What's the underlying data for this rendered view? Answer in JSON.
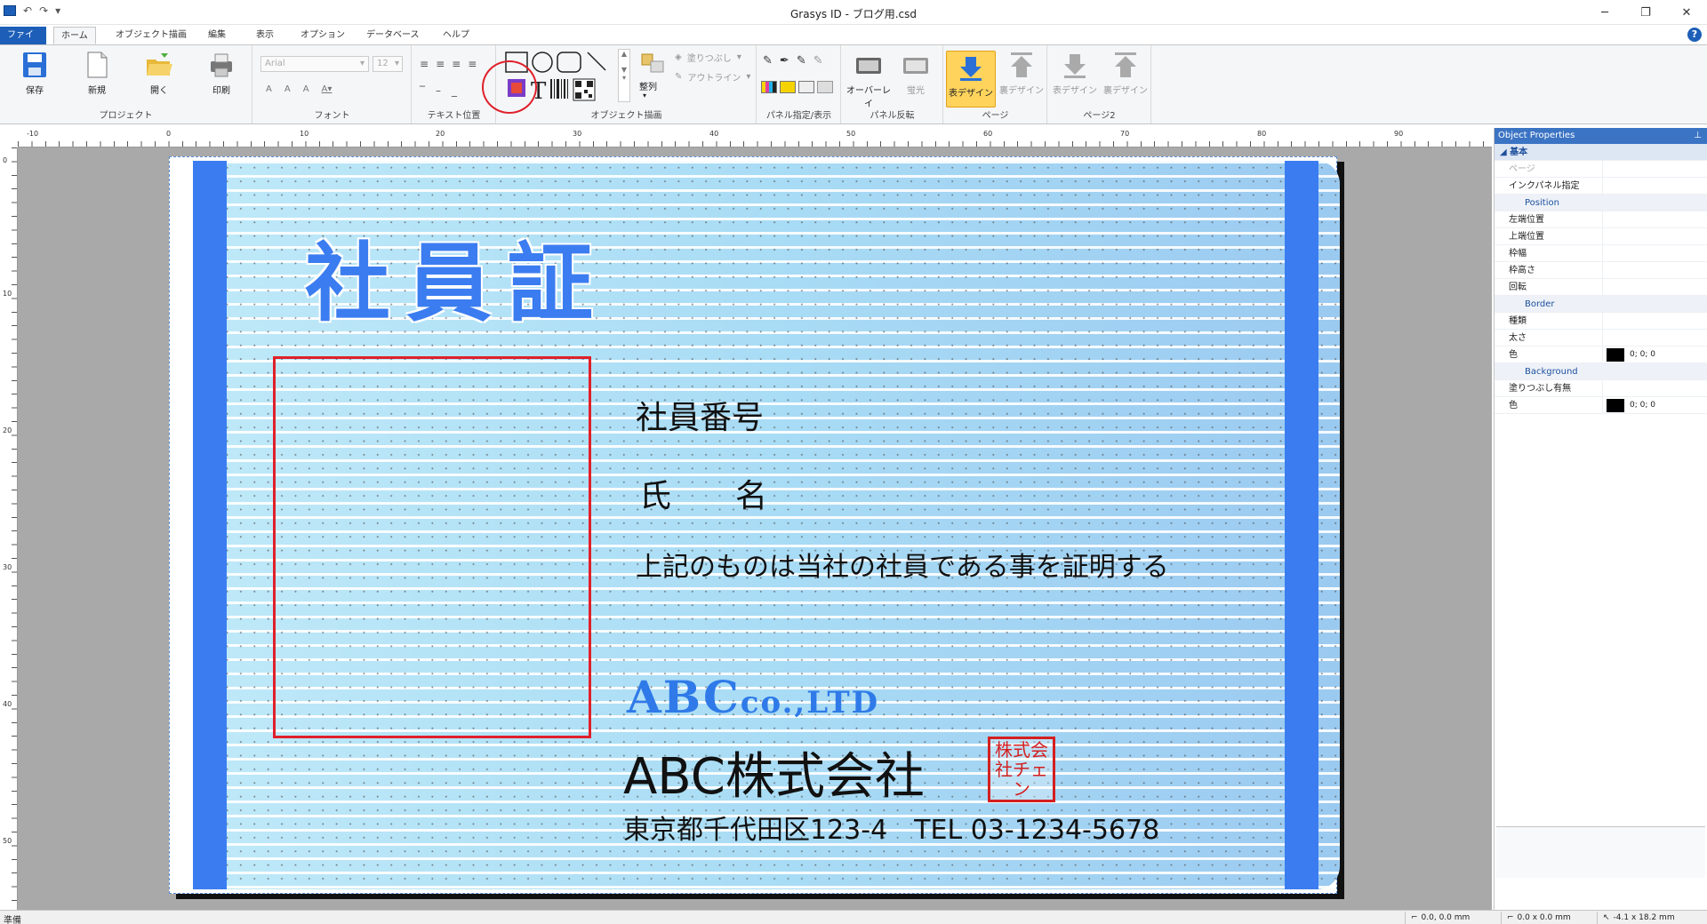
{
  "window": {
    "title": "Grasys ID - ブログ用.csd",
    "minimize": "─",
    "maximize": "❐",
    "close": "✕"
  },
  "tabs": [
    "ファイル",
    "ホーム",
    "オブジェクト描画",
    "編集",
    "表示",
    "オプション",
    "データベース",
    "ヘルプ"
  ],
  "ribbon": {
    "project": {
      "label": "プロジェクト",
      "save": "保存",
      "new": "新規",
      "open": "開く",
      "print": "印刷"
    },
    "font": {
      "label": "フォント",
      "family_value": "Arial",
      "size_value": "12"
    },
    "text_position": {
      "label": "テキスト位置"
    },
    "object_draw": {
      "label": "オブジェクト描画",
      "arrange": "整列",
      "fill": "塗りつぶし",
      "outline": "アウトライン"
    },
    "panel": {
      "label": "パネル指定/表示"
    },
    "panel_flip": {
      "label": "パネル反転",
      "overlay": "オーバーレイ",
      "fluorescent": "蛍光"
    },
    "page": {
      "label": "ページ",
      "front_design": "表デザイン",
      "back_design": "裏デザイン"
    },
    "page2": {
      "label": "ページ2",
      "front_design": "表デザイン",
      "back_design": "裏デザイン"
    }
  },
  "ruler": {
    "top": [
      "-10",
      "0",
      "10",
      "20",
      "30",
      "40",
      "50",
      "60",
      "70",
      "80",
      "90"
    ],
    "left": [
      "0",
      "10",
      "20",
      "30",
      "40",
      "50"
    ]
  },
  "card": {
    "title": "社員証",
    "employee_number_label": "社員番号",
    "name_label": "氏　　名",
    "certification": "上記のものは当社の社員である事を証明する",
    "logo_main": "ABC",
    "logo_sub": "co.,LTD",
    "company_name": "ABC株式会社",
    "stamp_text": "株式会社チェン",
    "address": "東京都千代田区123-4　TEL 03-1234-5678",
    "accent_color": "#3b7df0",
    "frame_color": "#e0202a"
  },
  "properties": {
    "title": "Object Properties",
    "pin": "ᵖ",
    "basic": "基本",
    "page": "ページ",
    "ink_panel": "インクパネル指定",
    "position": "Position",
    "left": "左端位置",
    "top": "上端位置",
    "width": "枠幅",
    "height": "枠高さ",
    "rotation": "回転",
    "border": "Border",
    "border_type": "種類",
    "border_width": "太さ",
    "border_color": "色",
    "border_color_value": "0; 0; 0",
    "background": "Background",
    "fill_enabled": "塗りつぶし有無",
    "bg_color": "色",
    "bg_color_value": "0; 0; 0"
  },
  "status": {
    "text": "準備",
    "position": "0.0, 0.0 mm",
    "size": "0.0 x 0.0 mm",
    "cursor": "-4.1 x 18.2 mm"
  }
}
